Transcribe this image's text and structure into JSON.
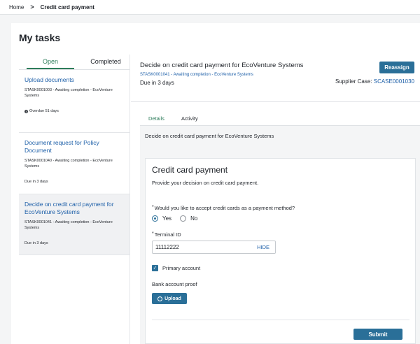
{
  "breadcrumb": {
    "home": "Home",
    "separator": ">",
    "current": "Credit card payment"
  },
  "page": {
    "title": "My tasks"
  },
  "task_list": {
    "tabs": [
      {
        "label": "Open",
        "active": true
      },
      {
        "label": "Completed",
        "active": false
      }
    ],
    "items": [
      {
        "title": "Upload documents",
        "meta": "STASK0001003 - Awaiting completion - EcoVenture Systems",
        "status": "Overdue 51 days",
        "alert_icon": "alert-circle-icon",
        "selected": false
      },
      {
        "title": "Document request for Policy Document",
        "meta": "STASK0001040 - Awaiting completion - EcoVenture Systems",
        "status": "Due in 3 days",
        "selected": false
      },
      {
        "title": "Decide on credit card payment for EcoVenture Systems",
        "meta": "STASK0001041 - Awaiting completion - EcoVenture Systems",
        "status": "Due in 3 days",
        "selected": true
      }
    ]
  },
  "task_detail": {
    "title": "Decide on credit card payment for EcoVenture Systems",
    "subtitle": "STASK0001041 - Awaiting completion - EcoVenture Systems",
    "due": "Due in 3 days",
    "reassign_label": "Reassign",
    "supplier_case_label": "Supplier Case:",
    "supplier_case_value": "SCASE0001030",
    "tabs": [
      {
        "label": "Details",
        "active": true
      },
      {
        "label": "Activity",
        "active": false
      }
    ],
    "content_header": "Decide on credit card payment for EcoVenture Systems"
  },
  "form": {
    "title": "Credit card payment",
    "subtitle": "Provide your decision on credit card payment.",
    "question": {
      "required_marker": "*",
      "label": "Would you like to accept credit cards as a payment method?",
      "options": [
        {
          "label": "Yes",
          "selected": true
        },
        {
          "label": "No",
          "selected": false
        }
      ]
    },
    "terminal": {
      "required_marker": "*",
      "label": "Terminal ID",
      "value": "11112222",
      "toggle_label": "HIDE"
    },
    "primary_account": {
      "label": "Primary account",
      "checked": true
    },
    "bank_proof_label": "Bank account proof",
    "upload_label": "Upload",
    "upload_icon": "upload-circle-icon",
    "submit_label": "Submit"
  },
  "colors": {
    "accent_blue": "#2a6f98",
    "link_blue": "#1d5fa8",
    "tab_green": "#2e7d5b",
    "page_bg": "#f4f5f6"
  }
}
